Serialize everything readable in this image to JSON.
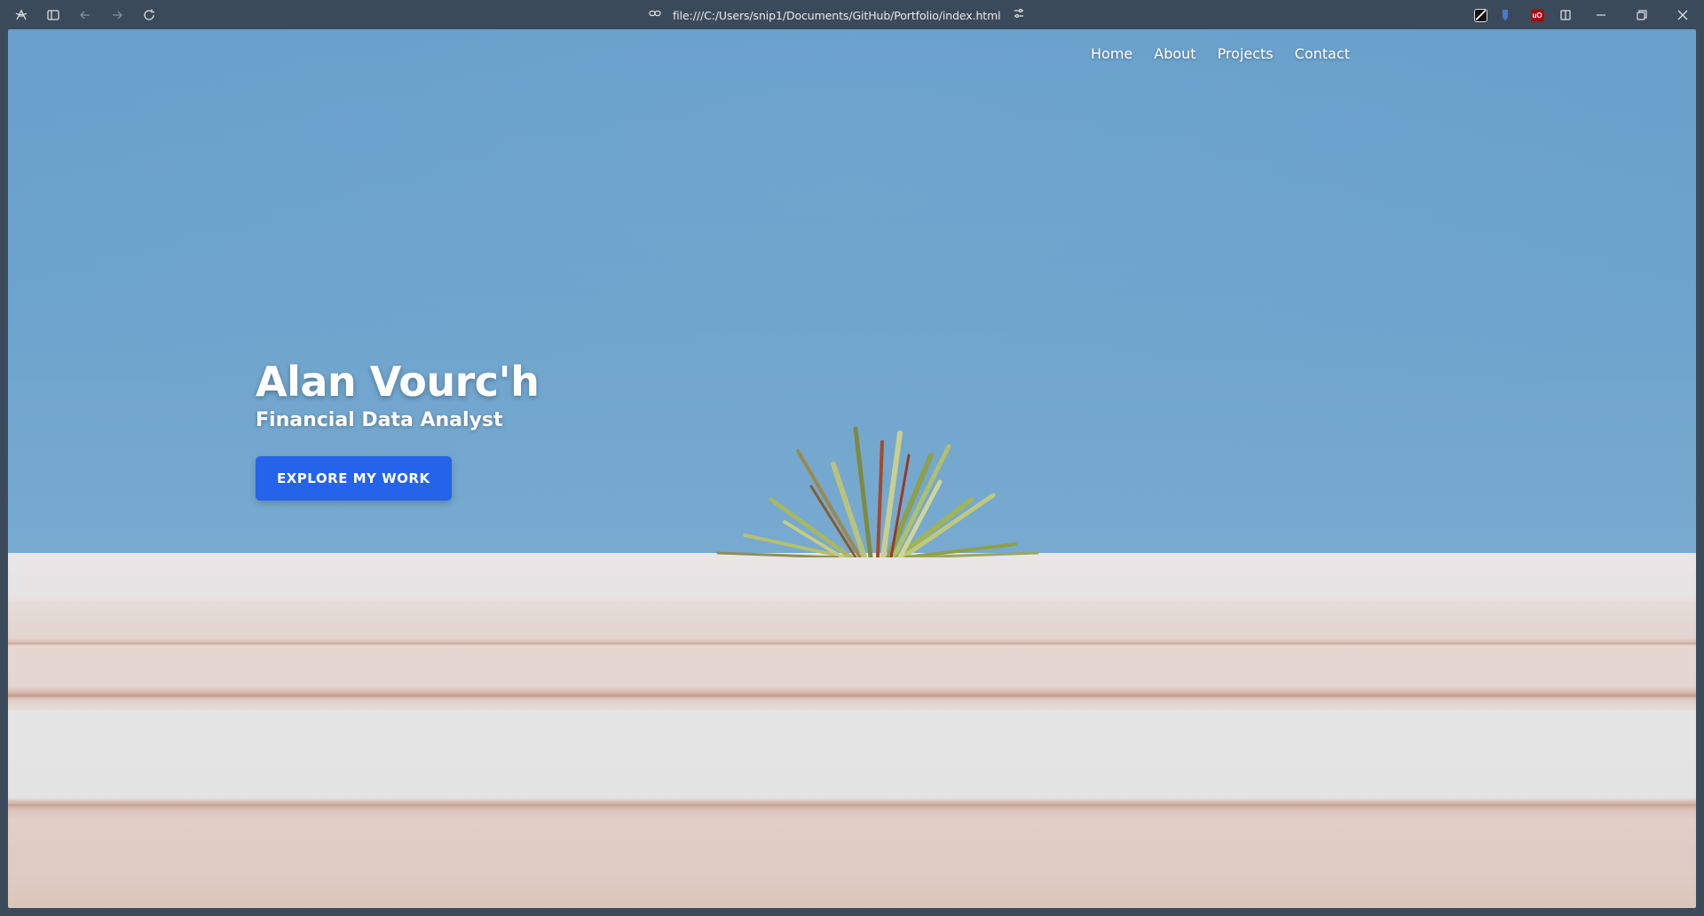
{
  "browser": {
    "url": "file:///C:/Users/snip1/Documents/GitHub/Portfolio/index.html",
    "extensions": [
      {
        "name": "dark-reader-icon",
        "color": "#1a1a1a"
      },
      {
        "name": "bitwarden-icon",
        "color": "#4c7ac9"
      },
      {
        "name": "ublock-origin-icon",
        "color": "#9e1111",
        "text": "uO"
      }
    ]
  },
  "nav": {
    "items": [
      {
        "label": "Home"
      },
      {
        "label": "About"
      },
      {
        "label": "Projects"
      },
      {
        "label": "Contact"
      }
    ]
  },
  "hero": {
    "name": "Alan Vourc'h",
    "role": "Financial Data Analyst",
    "cta_label": "EXPLORE MY WORK",
    "cta_color": "#2563eb"
  }
}
